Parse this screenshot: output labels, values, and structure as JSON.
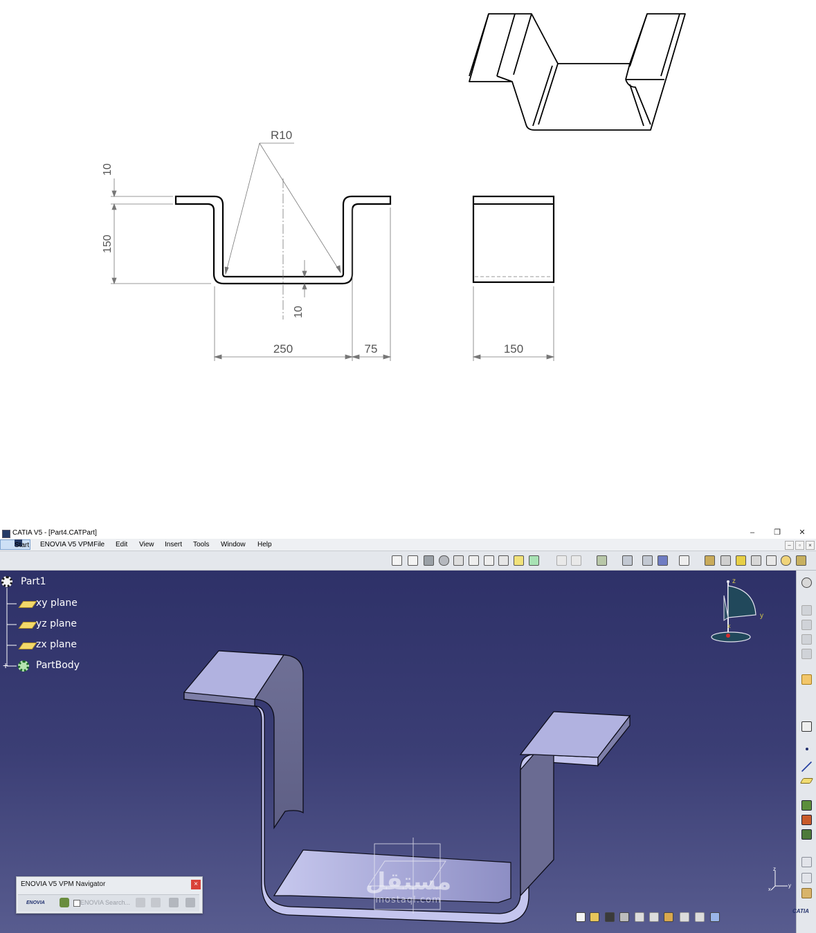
{
  "drawing": {
    "radius_label": "R10",
    "dim_thickness_top": "10",
    "dim_height": "150",
    "dim_thickness_bottom": "10",
    "dim_width": "250",
    "dim_flange": "75",
    "dim_depth": "150"
  },
  "window": {
    "title": "CATIA V5 - [Part4.CATPart]",
    "minimize": "–",
    "restore": "❐",
    "close": "✕"
  },
  "menu": {
    "start": "Start",
    "items": [
      "ENOVIA V5 VPM",
      "File",
      "Edit",
      "View",
      "Insert",
      "Tools",
      "Window",
      "Help"
    ],
    "mdi_min": "–",
    "mdi_restore": "▫",
    "mdi_close": "×"
  },
  "tree": {
    "root": "Part1",
    "planes": [
      "xy plane",
      "yz plane",
      "zx plane"
    ],
    "body": "PartBody"
  },
  "compass": {
    "z": "z",
    "y": "y",
    "x": "x"
  },
  "axis_triad": {
    "z": "z",
    "y": "y",
    "x": "x"
  },
  "navigator": {
    "title": "ENOVIA V5 VPM Navigator",
    "close": "×",
    "search": "ENOVIA Search...",
    "logo": "ENOVIA"
  },
  "brand": {
    "catia_logo": "CATIA"
  },
  "watermark": {
    "arabic": "مستقل",
    "latin": "mostaql.com"
  },
  "colors": {
    "viewport_top": "#2e3168",
    "viewport_bottom": "#585c8f",
    "part_face": "#a9a9d8",
    "part_side": "#6e6e93",
    "tree_text": "#ffffff",
    "plane_icon": "#f3d96a"
  }
}
